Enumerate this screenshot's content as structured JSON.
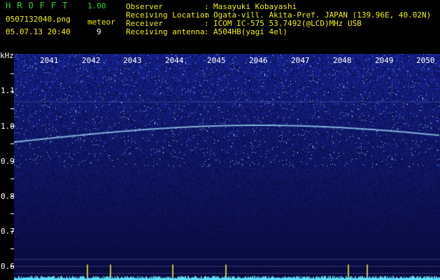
{
  "header": {
    "logo": "HROFFT",
    "version": "1.00",
    "filename": "0507132040.png",
    "datetime": "05.07.13 20:40",
    "meteor_label": "meteor",
    "meteor_count": "9"
  },
  "info": {
    "observer_key": "Observer",
    "observer_val": "Masayuki Kobayashi",
    "location_key": "Receiving Location",
    "location_val": "Ogata-vill. Akita-Pref. JAPAN (139.96E, 40.02N)",
    "receiver_key": "Receiver",
    "receiver_val": "ICOM IC-575 53.7492(@LCD)MHz USB",
    "antenna_key": "Receiving antenna",
    "antenna_val": "A504HB(yagi 4el)",
    "colon": ":"
  },
  "axis": {
    "unit": "kHz",
    "y_labels": [
      "1.1",
      "1.0",
      "0.9",
      "0.8",
      "0.7",
      "0.6"
    ],
    "x_labels": [
      "2041",
      "2042",
      "2043",
      "2044",
      "2045",
      "2046",
      "2047",
      "2048",
      "2049",
      "2050"
    ]
  },
  "colors": {
    "background": "#000000",
    "title_green": "#2fd42f",
    "value_yellow": "#f2f200",
    "spectrogram_blue": "#1a2a9a",
    "trace_cyan": "#a8e8ff"
  }
}
